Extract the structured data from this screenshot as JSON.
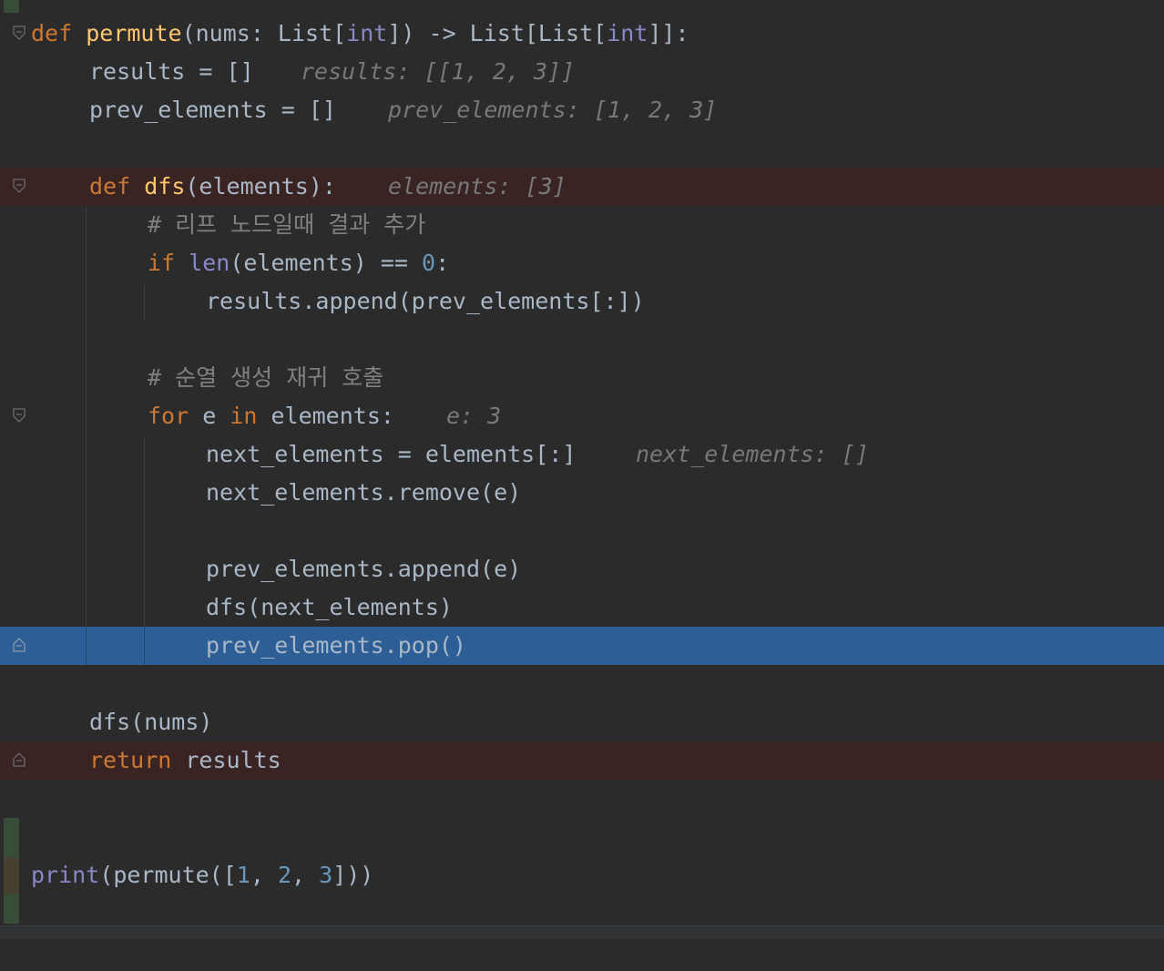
{
  "editor": {
    "language": "python",
    "colors": {
      "background": "#2b2b2b",
      "keyword": "#cc7832",
      "function": "#ffc66d",
      "builtin": "#8888c6",
      "number": "#6897bb",
      "comment": "#808080",
      "inline_hint": "#787878",
      "breakpoint_line": "#3a2323",
      "execution_line": "#2d5e96"
    },
    "lines": {
      "l1": {
        "kw_def": "def",
        "name": "permute",
        "sig_a": "(nums: List[",
        "t1": "int",
        "sig_b": "]) -> List[List[",
        "t2": "int",
        "sig_c": "]]:"
      },
      "l2": {
        "code": "results = []",
        "hint": "results: [[1, 2, 3]]"
      },
      "l3": {
        "code": "prev_elements = []",
        "hint": "prev_elements: [1, 2, 3]"
      },
      "l5": {
        "kw_def": "def",
        "name": "dfs",
        "rest": "(elements):",
        "hint": "elements: [3]"
      },
      "l6": {
        "comment": "# 리프 노드일때 결과 추가"
      },
      "l7": {
        "kw_if": "if",
        "builtin": "len",
        "mid": "(elements) == ",
        "num": "0",
        "end": ":"
      },
      "l8": {
        "code": "results.append(prev_elements[:])"
      },
      "l10": {
        "comment": "# 순열 생성 재귀 호출"
      },
      "l11": {
        "kw_for": "for",
        "var": " e ",
        "kw_in": "in",
        "rest": " elements:",
        "hint": "e: 3"
      },
      "l12": {
        "code": "next_elements = elements[:]",
        "hint": "next_elements: []"
      },
      "l13": {
        "code": "next_elements.remove(e)"
      },
      "l15": {
        "code": "prev_elements.append(e)"
      },
      "l16": {
        "code": "dfs(next_elements)"
      },
      "l17": {
        "code": "prev_elements.pop()"
      },
      "l19": {
        "code": "dfs(nums)"
      },
      "l20": {
        "kw_return": "return",
        "rest": " results"
      },
      "l23": {
        "builtin": "print",
        "a": "(permute([",
        "n1": "1",
        "c1": ", ",
        "n2": "2",
        "c2": ", ",
        "n3": "3",
        "b": "]))"
      }
    }
  }
}
